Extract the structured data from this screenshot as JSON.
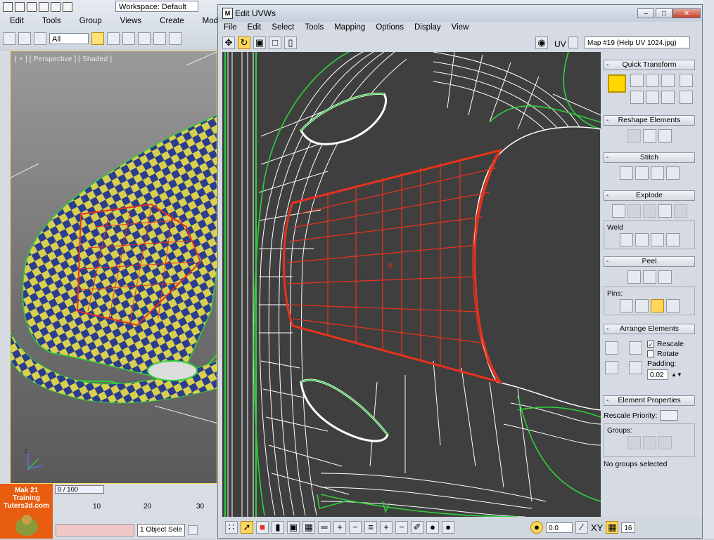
{
  "app": {
    "workspace_label": "Workspace: Default",
    "menu": [
      "Edit",
      "Tools",
      "Group",
      "Views",
      "Create",
      "Modifiers"
    ],
    "selection_filter": "All",
    "viewport_label": "[ + ] [ Perspective ] [ Shaded ]",
    "frame_slider": "0 / 100",
    "timeline_ticks": [
      "10",
      "20",
      "30"
    ],
    "logo_lines": [
      "Mak 21 Training",
      "Tuters3d.com"
    ],
    "object_selected": "1 Object Sele"
  },
  "uvw": {
    "title": "Edit UVWs",
    "logo_letter": "M",
    "menu": [
      "File",
      "Edit",
      "Select",
      "Tools",
      "Mapping",
      "Options",
      "Display",
      "View"
    ],
    "uv_label": "UV",
    "map_select": "Map #19 (Help UV 1024.jpg)",
    "bottom_value": "0.0",
    "coord_label": "XY",
    "grid_value": "16"
  },
  "panel": {
    "quick_transform": "Quick Transform",
    "reshape_elements": "Reshape Elements",
    "stitch": "Stitch",
    "explode": "Explode",
    "weld": "Weld",
    "peel": "Peel",
    "pins": "Pins:",
    "arrange_elements": "Arrange Elements",
    "rescale": "Rescale",
    "rescale_checked": true,
    "rotate": "Rotate",
    "rotate_checked": false,
    "padding_label": "Padding:",
    "padding_value": "0.02",
    "element_properties": "Element Properties",
    "rescale_priority": "Rescale Priority:",
    "groups": "Groups:",
    "no_groups": "No groups selected"
  },
  "colors": {
    "selection_red": "#e8321c",
    "uv_green": "#2fcf3a",
    "uv_white": "#ffffff",
    "canvas_bg": "#3f3f3f",
    "active_yellow": "#ffd75c"
  }
}
